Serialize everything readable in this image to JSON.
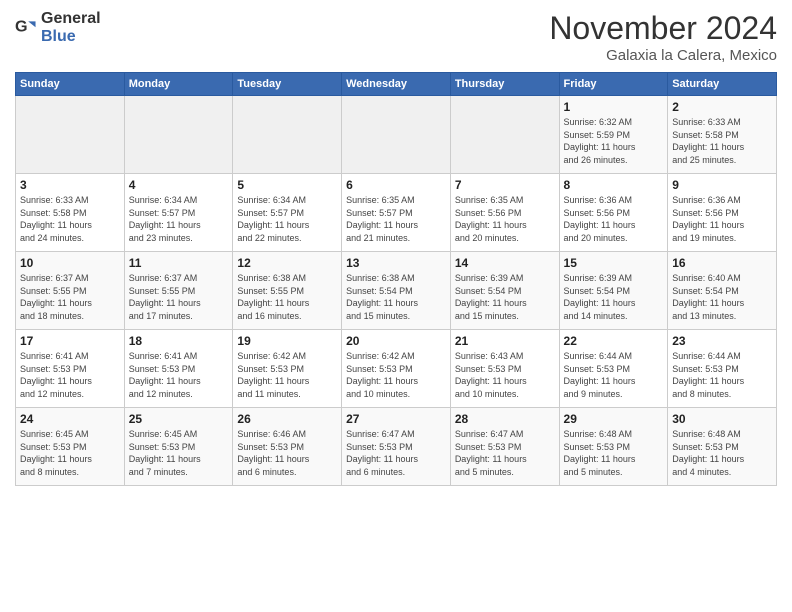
{
  "logo": {
    "general": "General",
    "blue": "Blue"
  },
  "header": {
    "month_year": "November 2024",
    "location": "Galaxia la Calera, Mexico"
  },
  "weekdays": [
    "Sunday",
    "Monday",
    "Tuesday",
    "Wednesday",
    "Thursday",
    "Friday",
    "Saturday"
  ],
  "rows": [
    [
      {
        "day": "",
        "info": ""
      },
      {
        "day": "",
        "info": ""
      },
      {
        "day": "",
        "info": ""
      },
      {
        "day": "",
        "info": ""
      },
      {
        "day": "",
        "info": ""
      },
      {
        "day": "1",
        "info": "Sunrise: 6:32 AM\nSunset: 5:59 PM\nDaylight: 11 hours\nand 26 minutes."
      },
      {
        "day": "2",
        "info": "Sunrise: 6:33 AM\nSunset: 5:58 PM\nDaylight: 11 hours\nand 25 minutes."
      }
    ],
    [
      {
        "day": "3",
        "info": "Sunrise: 6:33 AM\nSunset: 5:58 PM\nDaylight: 11 hours\nand 24 minutes."
      },
      {
        "day": "4",
        "info": "Sunrise: 6:34 AM\nSunset: 5:57 PM\nDaylight: 11 hours\nand 23 minutes."
      },
      {
        "day": "5",
        "info": "Sunrise: 6:34 AM\nSunset: 5:57 PM\nDaylight: 11 hours\nand 22 minutes."
      },
      {
        "day": "6",
        "info": "Sunrise: 6:35 AM\nSunset: 5:57 PM\nDaylight: 11 hours\nand 21 minutes."
      },
      {
        "day": "7",
        "info": "Sunrise: 6:35 AM\nSunset: 5:56 PM\nDaylight: 11 hours\nand 20 minutes."
      },
      {
        "day": "8",
        "info": "Sunrise: 6:36 AM\nSunset: 5:56 PM\nDaylight: 11 hours\nand 20 minutes."
      },
      {
        "day": "9",
        "info": "Sunrise: 6:36 AM\nSunset: 5:56 PM\nDaylight: 11 hours\nand 19 minutes."
      }
    ],
    [
      {
        "day": "10",
        "info": "Sunrise: 6:37 AM\nSunset: 5:55 PM\nDaylight: 11 hours\nand 18 minutes."
      },
      {
        "day": "11",
        "info": "Sunrise: 6:37 AM\nSunset: 5:55 PM\nDaylight: 11 hours\nand 17 minutes."
      },
      {
        "day": "12",
        "info": "Sunrise: 6:38 AM\nSunset: 5:55 PM\nDaylight: 11 hours\nand 16 minutes."
      },
      {
        "day": "13",
        "info": "Sunrise: 6:38 AM\nSunset: 5:54 PM\nDaylight: 11 hours\nand 15 minutes."
      },
      {
        "day": "14",
        "info": "Sunrise: 6:39 AM\nSunset: 5:54 PM\nDaylight: 11 hours\nand 15 minutes."
      },
      {
        "day": "15",
        "info": "Sunrise: 6:39 AM\nSunset: 5:54 PM\nDaylight: 11 hours\nand 14 minutes."
      },
      {
        "day": "16",
        "info": "Sunrise: 6:40 AM\nSunset: 5:54 PM\nDaylight: 11 hours\nand 13 minutes."
      }
    ],
    [
      {
        "day": "17",
        "info": "Sunrise: 6:41 AM\nSunset: 5:53 PM\nDaylight: 11 hours\nand 12 minutes."
      },
      {
        "day": "18",
        "info": "Sunrise: 6:41 AM\nSunset: 5:53 PM\nDaylight: 11 hours\nand 12 minutes."
      },
      {
        "day": "19",
        "info": "Sunrise: 6:42 AM\nSunset: 5:53 PM\nDaylight: 11 hours\nand 11 minutes."
      },
      {
        "day": "20",
        "info": "Sunrise: 6:42 AM\nSunset: 5:53 PM\nDaylight: 11 hours\nand 10 minutes."
      },
      {
        "day": "21",
        "info": "Sunrise: 6:43 AM\nSunset: 5:53 PM\nDaylight: 11 hours\nand 10 minutes."
      },
      {
        "day": "22",
        "info": "Sunrise: 6:44 AM\nSunset: 5:53 PM\nDaylight: 11 hours\nand 9 minutes."
      },
      {
        "day": "23",
        "info": "Sunrise: 6:44 AM\nSunset: 5:53 PM\nDaylight: 11 hours\nand 8 minutes."
      }
    ],
    [
      {
        "day": "24",
        "info": "Sunrise: 6:45 AM\nSunset: 5:53 PM\nDaylight: 11 hours\nand 8 minutes."
      },
      {
        "day": "25",
        "info": "Sunrise: 6:45 AM\nSunset: 5:53 PM\nDaylight: 11 hours\nand 7 minutes."
      },
      {
        "day": "26",
        "info": "Sunrise: 6:46 AM\nSunset: 5:53 PM\nDaylight: 11 hours\nand 6 minutes."
      },
      {
        "day": "27",
        "info": "Sunrise: 6:47 AM\nSunset: 5:53 PM\nDaylight: 11 hours\nand 6 minutes."
      },
      {
        "day": "28",
        "info": "Sunrise: 6:47 AM\nSunset: 5:53 PM\nDaylight: 11 hours\nand 5 minutes."
      },
      {
        "day": "29",
        "info": "Sunrise: 6:48 AM\nSunset: 5:53 PM\nDaylight: 11 hours\nand 5 minutes."
      },
      {
        "day": "30",
        "info": "Sunrise: 6:48 AM\nSunset: 5:53 PM\nDaylight: 11 hours\nand 4 minutes."
      }
    ]
  ]
}
